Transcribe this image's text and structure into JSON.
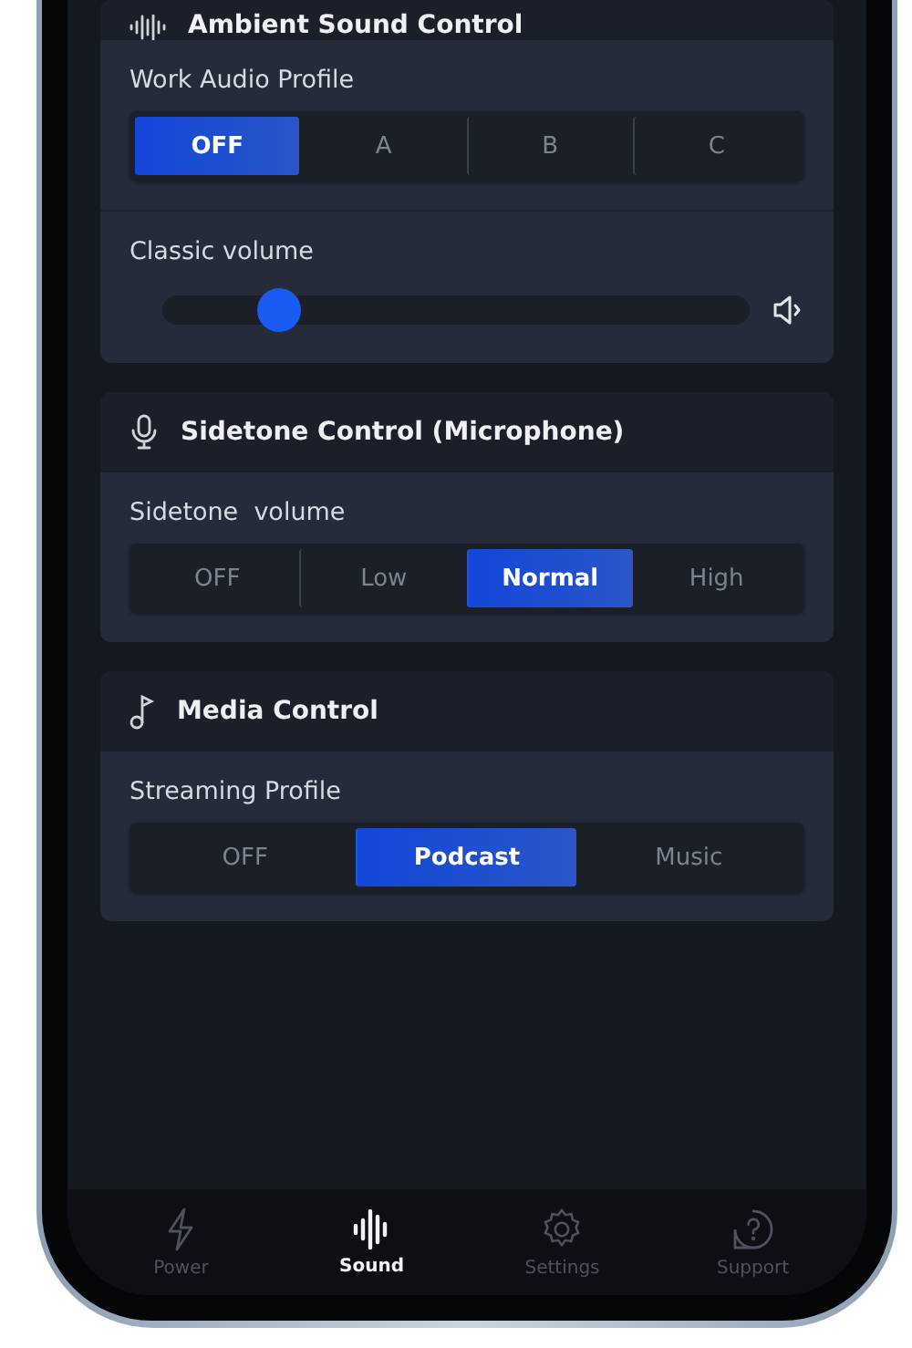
{
  "sections": [
    {
      "kind": "ambient",
      "title": "Ambient Sound Control",
      "controls": [
        {
          "kind": "segmented",
          "label": "Work Audio Profile",
          "options": [
            {
              "label": "OFF",
              "selected": true
            },
            {
              "label": "A",
              "selected": false
            },
            {
              "label": "B",
              "selected": false
            },
            {
              "label": "C",
              "selected": false
            }
          ]
        },
        {
          "kind": "slider",
          "label": "Classic volume",
          "level": 0.2
        }
      ]
    },
    {
      "kind": "sidetone",
      "title": "Sidetone Control (Microphone)",
      "controls": [
        {
          "kind": "segmented",
          "label": "Sidetone  volume",
          "options": [
            {
              "label": "OFF",
              "selected": false
            },
            {
              "label": "Low",
              "selected": false
            },
            {
              "label": "Normal",
              "selected": true
            },
            {
              "label": "High",
              "selected": false
            }
          ]
        }
      ]
    },
    {
      "kind": "media",
      "title": "Media Control",
      "controls": [
        {
          "kind": "segmented",
          "label": "Streaming Profile",
          "options": [
            {
              "label": "OFF",
              "selected": false
            },
            {
              "label": "Podcast",
              "selected": true
            },
            {
              "label": "Music",
              "selected": false
            }
          ]
        }
      ]
    }
  ],
  "tab_bar": [
    {
      "kind": "power",
      "label": "Power",
      "selected": false
    },
    {
      "kind": "sound",
      "label": "Sound",
      "selected": true
    },
    {
      "kind": "settings",
      "label": "Settings",
      "selected": false
    },
    {
      "kind": "support",
      "label": "Support",
      "selected": false
    }
  ]
}
